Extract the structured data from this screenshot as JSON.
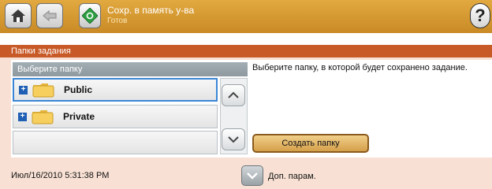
{
  "topbar": {
    "job_title": "Сохр. в память у-ва",
    "job_status": "Готов",
    "help_label": "?"
  },
  "section": {
    "title": "Папки задания"
  },
  "folder_list": {
    "header": "Выберите папку",
    "items": [
      {
        "label": "Public",
        "selected": true
      },
      {
        "label": "Private",
        "selected": false
      },
      {
        "label": "",
        "selected": false
      }
    ]
  },
  "instruction": "Выберите папку, в которой будет сохранено задание.",
  "create_folder_label": "Создать папку",
  "footer": {
    "datetime": "Июл/16/2010 5:31:38 PM",
    "more_options_label": "Доп. парам."
  },
  "colors": {
    "topbar": "#d79a30",
    "section_header": "#c85a27",
    "panel_bg": "#f8e1d4",
    "selection_border": "#3a86d6"
  }
}
